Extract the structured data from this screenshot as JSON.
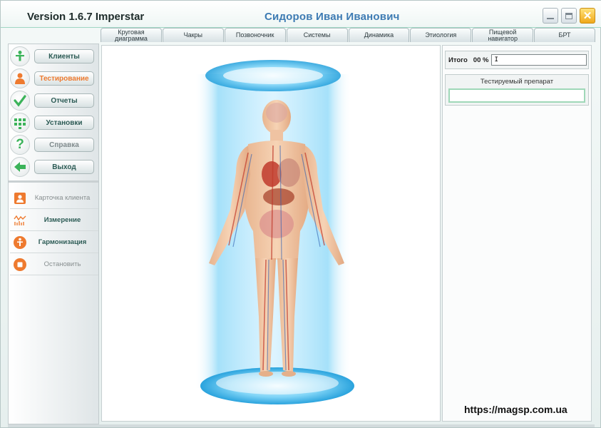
{
  "window": {
    "version": "Version 1.6.7 Imperstar",
    "patient_name": "Сидоров Иван  Иванович",
    "controls": {
      "minimize_icon": "minimize-icon",
      "maximize_icon": "restore-icon",
      "close_icon": "close-icon"
    }
  },
  "tabs": [
    {
      "label": "Круговая диаграмма"
    },
    {
      "label": "Чакры"
    },
    {
      "label": "Позвоночник"
    },
    {
      "label": "Системы"
    },
    {
      "label": "Динамика"
    },
    {
      "label": "Этиология"
    },
    {
      "label": "Пищевой навигатор"
    },
    {
      "label": "БРТ"
    }
  ],
  "sidebar": {
    "nav": [
      {
        "label": "Клиенты",
        "icon": "person-icon",
        "state": "normal"
      },
      {
        "label": "Тестирование",
        "icon": "user-test-icon",
        "state": "active"
      },
      {
        "label": "Отчеты",
        "icon": "checkmark-icon",
        "state": "normal"
      },
      {
        "label": "Установки",
        "icon": "grid-settings-icon",
        "state": "normal"
      },
      {
        "label": "Справка",
        "icon": "question-icon",
        "state": "dim"
      },
      {
        "label": "Выход",
        "icon": "arrow-left-icon",
        "state": "normal"
      }
    ],
    "actions": [
      {
        "label": "Карточка клиента",
        "icon": "client-card-icon",
        "state": "dim"
      },
      {
        "label": "Измерение",
        "icon": "measurement-icon",
        "state": "normal"
      },
      {
        "label": "Гармонизация",
        "icon": "harmonize-icon",
        "state": "normal"
      },
      {
        "label": "Остановить",
        "icon": "stop-icon",
        "state": "dim"
      }
    ]
  },
  "right_panel": {
    "total_label": "Итого",
    "total_value": "00 %",
    "total_field_value": "I",
    "tested_drug_label": "Тестируемый препарат",
    "tested_drug_value": ""
  },
  "watermark": "https://magsp.com.ua",
  "colors": {
    "accent_green": "#2b5a54",
    "active_orange": "#ee7a2f",
    "patient_blue": "#3d7bb3",
    "beam_blue": "#3fb7ef"
  }
}
